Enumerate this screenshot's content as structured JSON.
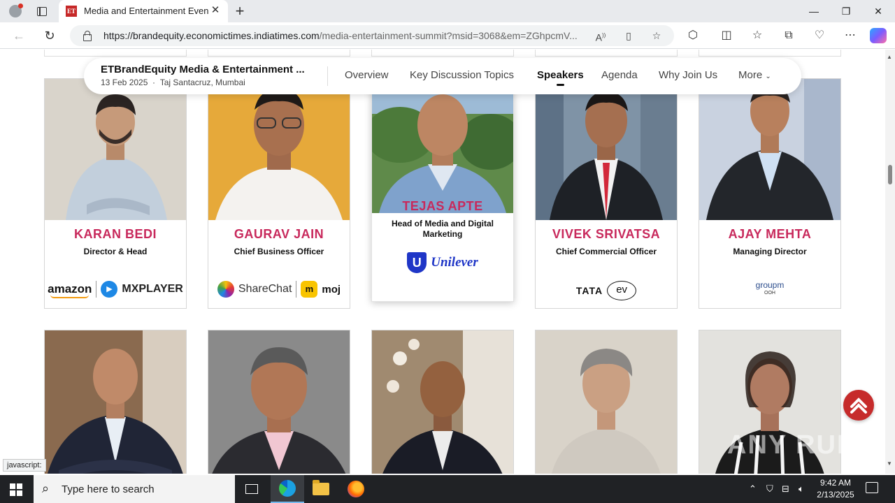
{
  "browser": {
    "tab_title": "Media and Entertainment Event |",
    "tab_favicon": "ET",
    "url_domain": "https://brandequity.economictimes.indiatimes.com",
    "url_path": "/media-entertainment-summit?msid=3068&em=ZGhpcmV...",
    "status_tip": "javascript:"
  },
  "header": {
    "event_title": "ETBrandEquity Media & Entertainment ...",
    "event_date": "13 Feb 2025",
    "event_venue": "Taj Santacruz, Mumbai",
    "menu": [
      "Overview",
      "Key Discussion Topics",
      "Speakers",
      "Agenda",
      "Why Join Us",
      "More"
    ],
    "active_menu": "Speakers"
  },
  "speakers_row1": [
    {
      "name": "KARAN BEDI",
      "role": "Director & Head",
      "logo": "amazon | MX PLAYER",
      "logo_parts": [
        "amazon",
        "MXPLAYER"
      ]
    },
    {
      "name": "GAURAV JAIN",
      "role": "Chief Business Officer",
      "logo": "ShareChat | moj",
      "logo_parts": [
        "ShareChat",
        "moj"
      ]
    },
    {
      "name": "TEJAS APTE",
      "role": "Head of Media and Digital Marketing",
      "logo": "Unilever",
      "logo_parts": [
        "Unilever"
      ]
    },
    {
      "name": "VIVEK SRIVATSA",
      "role": "Chief Commercial Officer",
      "logo": "TATA ev",
      "logo_parts": [
        "TATA",
        "ev"
      ]
    },
    {
      "name": "AJAY MEHTA",
      "role": "Managing Director",
      "logo": "groupm OOH Solutions",
      "logo_parts": [
        "groupm",
        "OOH"
      ]
    }
  ],
  "taskbar": {
    "search_placeholder": "Type here to search",
    "time": "9:42 AM",
    "date": "2/13/2025"
  },
  "watermark": "ANY RUN",
  "colors": {
    "speaker_name": "#c8295c",
    "scroll_top_button": "#c62b2b",
    "taskbar": "#202225"
  }
}
